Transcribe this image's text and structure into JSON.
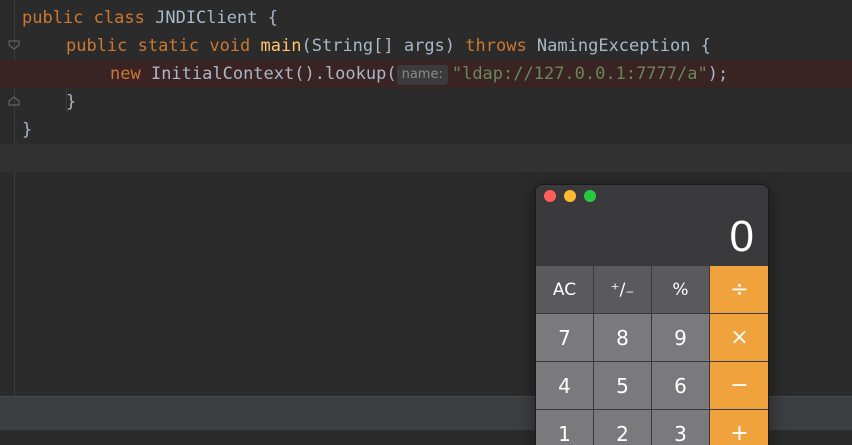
{
  "editor": {
    "lines": [
      {
        "kw1": "public",
        "kw2": "class",
        "name": "JNDIClient",
        "rest": " {"
      },
      {
        "kw1": "public",
        "kw2": "static",
        "kw3": "void",
        "fn": "main",
        "args": "(String[] args) ",
        "kw4": "throws",
        "exc": " NamingException {"
      },
      {
        "kw1": "new",
        "call": " InitialContext().lookup(",
        "hint": "name:",
        "str": "\"ldap://127.0.0.1:7777/a\"",
        "end": ");"
      },
      {
        "text": "}"
      },
      {
        "text": "}"
      }
    ]
  },
  "calculator": {
    "display": "0",
    "rows": [
      [
        "AC",
        "⁺∕₋",
        "%",
        "÷"
      ],
      [
        "7",
        "8",
        "9",
        "×"
      ],
      [
        "4",
        "5",
        "6",
        "−"
      ],
      [
        "1",
        "2",
        "3",
        "+"
      ]
    ]
  }
}
